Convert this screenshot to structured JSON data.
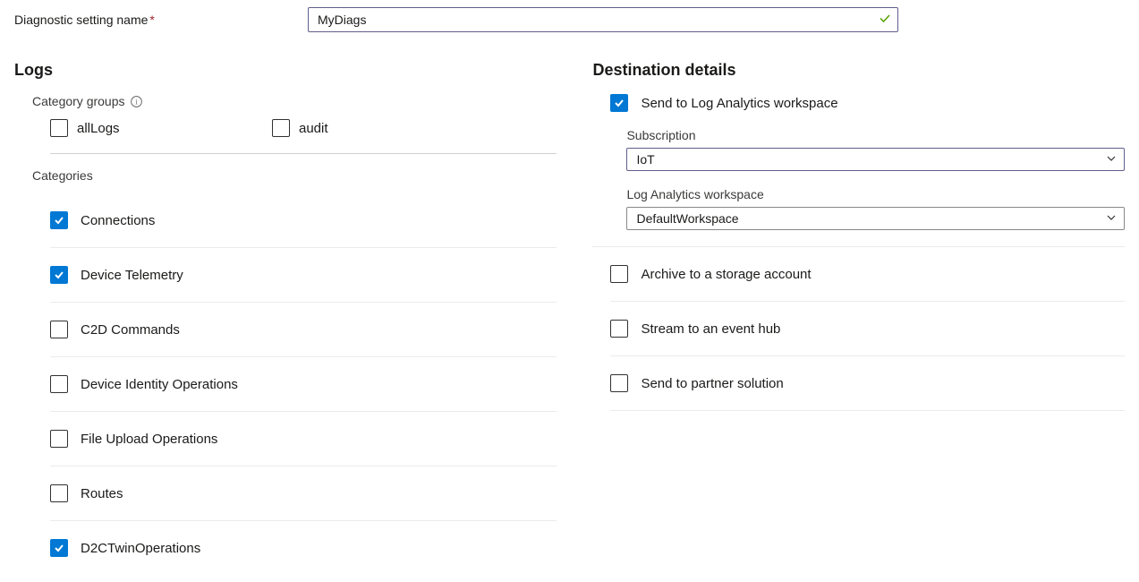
{
  "name_field": {
    "label": "Diagnostic setting name",
    "value": "MyDiags"
  },
  "logs": {
    "title": "Logs",
    "category_groups_label": "Category groups",
    "groups": [
      {
        "label": "allLogs",
        "checked": false
      },
      {
        "label": "audit",
        "checked": false
      }
    ],
    "categories_label": "Categories",
    "categories": [
      {
        "label": "Connections",
        "checked": true
      },
      {
        "label": "Device Telemetry",
        "checked": true
      },
      {
        "label": "C2D Commands",
        "checked": false
      },
      {
        "label": "Device Identity Operations",
        "checked": false
      },
      {
        "label": "File Upload Operations",
        "checked": false
      },
      {
        "label": "Routes",
        "checked": false
      },
      {
        "label": "D2CTwinOperations",
        "checked": true
      }
    ]
  },
  "destination": {
    "title": "Destination details",
    "send_law": {
      "label": "Send to Log Analytics workspace",
      "checked": true
    },
    "subscription": {
      "label": "Subscription",
      "value": "IoT"
    },
    "workspace": {
      "label": "Log Analytics workspace",
      "value": "DefaultWorkspace"
    },
    "options": [
      {
        "label": "Archive to a storage account",
        "checked": false
      },
      {
        "label": "Stream to an event hub",
        "checked": false
      },
      {
        "label": "Send to partner solution",
        "checked": false
      }
    ]
  }
}
